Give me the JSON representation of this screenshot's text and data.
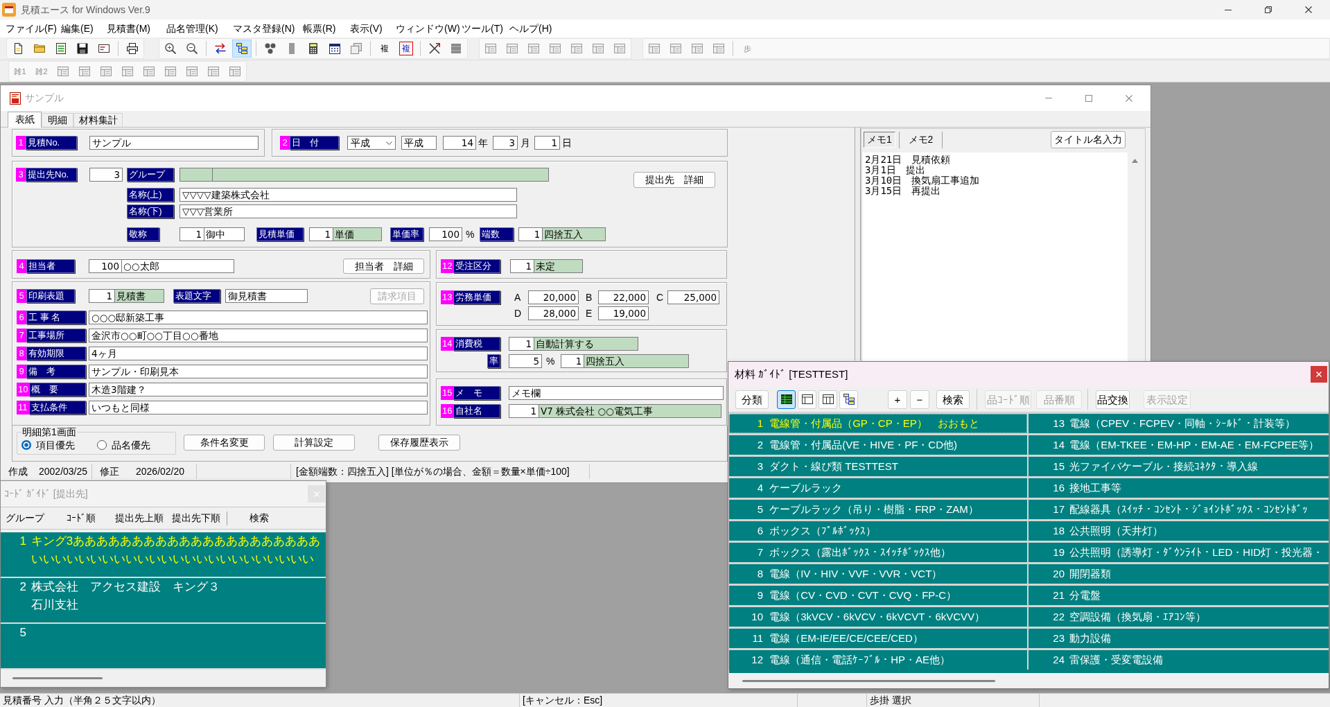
{
  "app": {
    "title": "見積エース for Windows Ver.9",
    "menu": [
      "ファイル(F)",
      "編集(E)",
      "見積書(M)",
      "品名管理(K)",
      "マスタ登録(N)",
      "帳票(R)",
      "表示(V)",
      "ウィンドウ(W)",
      "ツール(T)",
      "ヘルプ(H)"
    ]
  },
  "toolbar": {
    "tree_view_pressed": true,
    "row_1_labels": [
      {
        "label": "複",
        "kind": "plain"
      },
      {
        "label": "複",
        "kind": "framed"
      },
      {
        "label": "歩",
        "kind": "grayed"
      }
    ],
    "row_2_labels": [
      {
        "label": "雑1",
        "kind": "grayed"
      },
      {
        "label": "雑2",
        "kind": "grayed"
      }
    ]
  },
  "document_window": {
    "title": "サンプル",
    "active": false,
    "tabs": [
      {
        "label": "表紙",
        "selected": true
      },
      {
        "label": "明細",
        "selected": false
      },
      {
        "label": "材料集計",
        "selected": false
      }
    ],
    "estimate_number": {
      "no": "1",
      "label": "見積No.",
      "value": "サンプル"
    },
    "date": {
      "no": "2",
      "label": "日　付",
      "era_dropdown": "平成",
      "era": "平成",
      "year": "14",
      "year_unit": "年",
      "month": "3",
      "month_unit": "月",
      "day": "1",
      "day_unit": "日"
    },
    "client": {
      "no": "3",
      "label": "提出先No.",
      "code": "3",
      "group_label": "グループ",
      "detail_button": "提出先　詳細",
      "name_upper_label": "名称(上)",
      "name_upper": "▽▽▽▽建築株式会社",
      "name_lower_label": "名称(下)",
      "name_lower": "▽▽▽営業所",
      "honorific_label": "敬称",
      "honorific_code": "1",
      "honorific": "御中",
      "unit_price_label": "見積単価",
      "unit_price_code": "1",
      "unit_price": "単価",
      "rate_label": "単価率",
      "rate": "100",
      "rate_unit": "%",
      "rounding_label": "端数",
      "rounding_code": "1",
      "rounding": "四捨五入"
    },
    "staff": {
      "no": "4",
      "label": "担当者",
      "code": "100",
      "name": "○○太郎",
      "detail_button": "担当者　詳細"
    },
    "print_title": {
      "no": "5",
      "label": "印刷表題",
      "code": "1",
      "value": "見積書",
      "heading_label": "表題文字",
      "heading": "御見積書",
      "billing_button": {
        "label": "請求項目",
        "disabled": true
      }
    },
    "text_fields": [
      {
        "no": "6",
        "label": "工 事 名",
        "value": "○○○邸新築工事"
      },
      {
        "no": "7",
        "label": "工事場所",
        "value": "金沢市○○町○○丁目○○番地"
      },
      {
        "no": "8",
        "label": "有効期限",
        "value": "4ヶ月"
      },
      {
        "no": "9",
        "label": "備　考",
        "value": "サンプル・印刷見本"
      },
      {
        "no": "10",
        "label": "概　要",
        "value": "木造3階建？"
      },
      {
        "no": "11",
        "label": "支払条件",
        "value": "いつもと同様"
      }
    ],
    "order_type": {
      "no": "12",
      "label": "受注区分",
      "code": "1",
      "value": "未定"
    },
    "labor_rates": {
      "no": "13",
      "label": "労務単価",
      "rates": [
        {
          "key": "A",
          "value": "20,000"
        },
        {
          "key": "B",
          "value": "22,000"
        },
        {
          "key": "C",
          "value": "25,000"
        },
        {
          "key": "D",
          "value": "28,000"
        },
        {
          "key": "E",
          "value": "19,000"
        }
      ]
    },
    "tax": {
      "no": "14",
      "label": "消費税",
      "code": "1",
      "value": "自動計算する",
      "rate_label": "率",
      "rate": "5",
      "rate_unit": "%",
      "rounding_code": "1",
      "rounding": "四捨五入"
    },
    "memo": {
      "no": "15",
      "label": "メ　モ",
      "value": "メモ欄"
    },
    "company": {
      "no": "16",
      "label": "自社名",
      "code": "1",
      "value": "V7 株式会社 ○○電気工事"
    },
    "first_detail_screen": {
      "legend": "明細第1画面",
      "options": [
        {
          "label": "項目優先",
          "selected": true
        },
        {
          "label": "品名優先",
          "selected": false
        }
      ]
    },
    "buttons": [
      "条件名変更",
      "計算設定",
      "保存履歴表示"
    ],
    "footer": {
      "created_label": "作成",
      "created": "2002/03/25",
      "modified_label": "修正",
      "modified": "2026/02/20",
      "note": "[金額端数：四捨五入] [単位が％の場合、金額＝数量×単価÷100]"
    },
    "memo_panel": {
      "tabs": [
        {
          "label": "メモ1",
          "selected": true
        },
        {
          "label": "メモ2",
          "selected": false
        }
      ],
      "title_button": "タイトル名入力",
      "lines": [
        "2月21日　見積依頼",
        "3月1日　提出",
        "3月10日　換気扇工事追加",
        "3月15日　再提出"
      ]
    }
  },
  "code_guide": {
    "title": "ｺｰﾄﾞ ｶﾞｲﾄﾞ [提出先]",
    "active": false,
    "toolbar": [
      "グループ",
      "ｺｰﾄﾞ順",
      "提出先上順",
      "提出先下順",
      "検索"
    ],
    "rows": [
      {
        "no": "1",
        "lines": [
          "キング3あああああああああああああああああああああ",
          "いいいいいいいいいいいいいいいいいいいいいいいい"
        ],
        "selected": true
      },
      {
        "no": "2",
        "lines": [
          "株式会社　アクセス建設　キング３",
          "石川支社"
        ],
        "selected": false
      },
      {
        "no": "5",
        "selected": false
      }
    ]
  },
  "material_guide": {
    "title": "材料 ｶﾞｲﾄﾞ [TESTTEST]",
    "active": true,
    "category_button": "分類",
    "view_buttons": [
      {
        "selected": true
      },
      {
        "selected": false
      },
      {
        "selected": false
      },
      {
        "selected": false
      }
    ],
    "add_button": "+",
    "remove_button": "−",
    "search_button": "検索",
    "sort_buttons": [
      {
        "label": "品ｺｰﾄﾞ順",
        "disabled": true
      },
      {
        "label": "品番順",
        "disabled": true
      }
    ],
    "swap_button": {
      "label": "品交換",
      "disabled": false
    },
    "settings_button": {
      "label": "表示設定",
      "disabled": true
    },
    "items": [
      {
        "no": "1",
        "label": "電線管・付属品（GP・CP・EP）　おおもと",
        "selected": true
      },
      {
        "no": "2",
        "label": "電線管・付属品(VE・HIVE・PF・CD他)",
        "selected": false
      },
      {
        "no": "3",
        "label": "ダクト・線ぴ類 TESTTEST",
        "selected": false
      },
      {
        "no": "4",
        "label": "ケーブルラック",
        "selected": false
      },
      {
        "no": "5",
        "label": "ケーブルラック（吊り・樹脂・FRP・ZAM）",
        "selected": false
      },
      {
        "no": "6",
        "label": "ボックス（ﾌﾟﾙﾎﾞｯｸｽ）",
        "selected": false
      },
      {
        "no": "7",
        "label": "ボックス（露出ﾎﾞｯｸｽ・ｽｲｯﾁﾎﾞｯｸｽ他）",
        "selected": false
      },
      {
        "no": "8",
        "label": "電線（IV・HIV・VVF・VVR・VCT）",
        "selected": false
      },
      {
        "no": "9",
        "label": "電線（CV・CVD・CVT・CVQ・FP-C）",
        "selected": false
      },
      {
        "no": "10",
        "label": "電線（3kVCV・6kVCV・6kVCVT・6kVCVV）",
        "selected": false
      },
      {
        "no": "11",
        "label": "電線（EM-IE/EE/CE/CEE/CED）",
        "selected": false
      },
      {
        "no": "12",
        "label": "電線（通信・電話ｹｰﾌﾞﾙ・HP・AE他）",
        "selected": false
      },
      {
        "no": "13",
        "label": "電線（CPEV・FCPEV・同軸・ｼｰﾙﾄﾞ・計装等）",
        "selected": false
      },
      {
        "no": "14",
        "label": "電線（EM-TKEE・EM-HP・EM-AE・EM-FCPEE等）",
        "selected": false
      },
      {
        "no": "15",
        "label": "光ファイバケーブル・接続ｺﾈｸﾀ・導入線",
        "selected": false
      },
      {
        "no": "16",
        "label": "接地工事等",
        "selected": false
      },
      {
        "no": "17",
        "label": "配線器具（ｽｲｯﾁ・ｺﾝｾﾝﾄ・ｼﾞｮｲﾝﾄﾎﾞｯｸｽ・ｺﾝｾﾝﾄﾎﾞｯ",
        "selected": false
      },
      {
        "no": "18",
        "label": "公共照明（天井灯）",
        "selected": false
      },
      {
        "no": "19",
        "label": "公共照明（誘導灯・ﾀﾞｳﾝﾗｲﾄ・LED・HID灯・投光器・",
        "selected": false
      },
      {
        "no": "20",
        "label": "開閉器類",
        "selected": false
      },
      {
        "no": "21",
        "label": "分電盤",
        "selected": false
      },
      {
        "no": "22",
        "label": "空調設備（換気扇・ｴｱｺﾝ等）",
        "selected": false
      },
      {
        "no": "23",
        "label": "動力設備",
        "selected": false
      },
      {
        "no": "24",
        "label": "雷保護・受変電設備",
        "selected": false
      }
    ]
  },
  "status_bar": [
    "見積番号 入力（半角２５文字以内）",
    "[キャンセル：Esc]",
    "歩掛 選択"
  ]
}
